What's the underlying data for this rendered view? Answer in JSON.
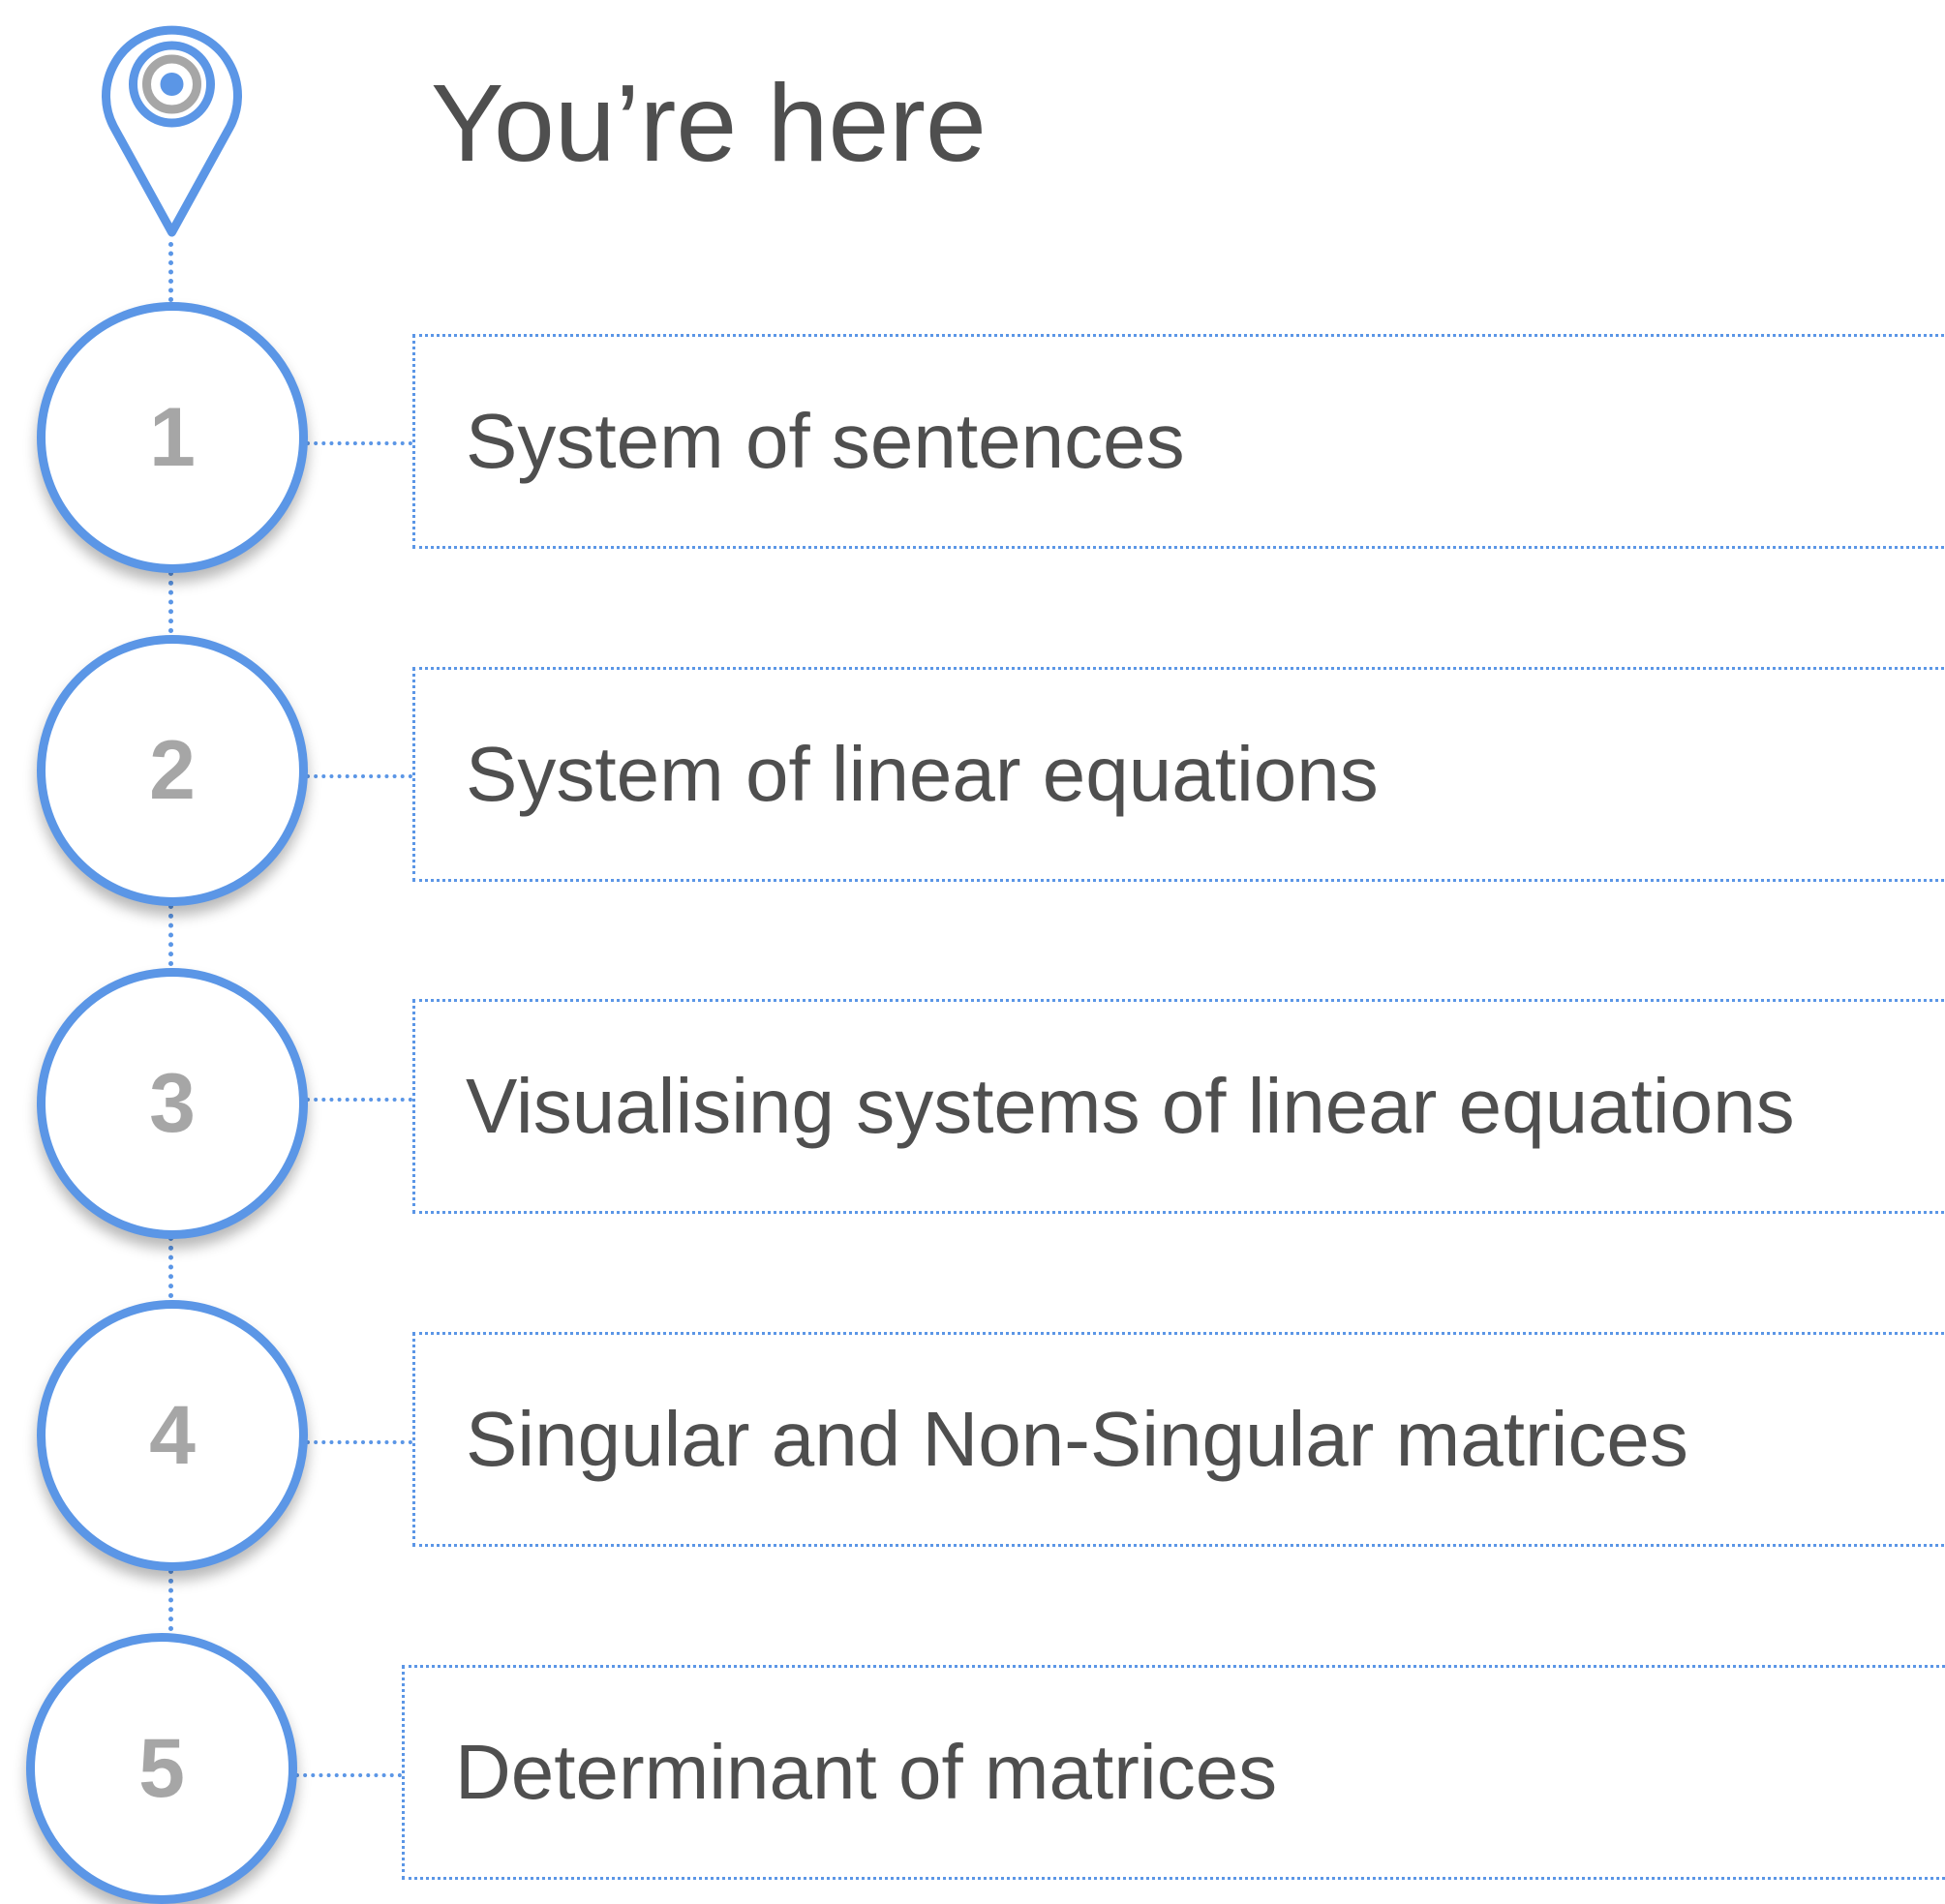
{
  "title": "You’re here",
  "colors": {
    "accent": "#5b96e6",
    "text": "#4f4f4f",
    "number": "#a6a6a6",
    "pin_inner": "#a6a6a6"
  },
  "icons": {
    "location": "location-pin-icon"
  },
  "steps": [
    {
      "number": "1",
      "label": "System of sentences"
    },
    {
      "number": "2",
      "label": "System of linear equations"
    },
    {
      "number": "3",
      "label": "Visualising systems of linear equations"
    },
    {
      "number": "4",
      "label": "Singular and Non-Singular matrices"
    },
    {
      "number": "5",
      "label": "Determinant of matrices"
    }
  ]
}
